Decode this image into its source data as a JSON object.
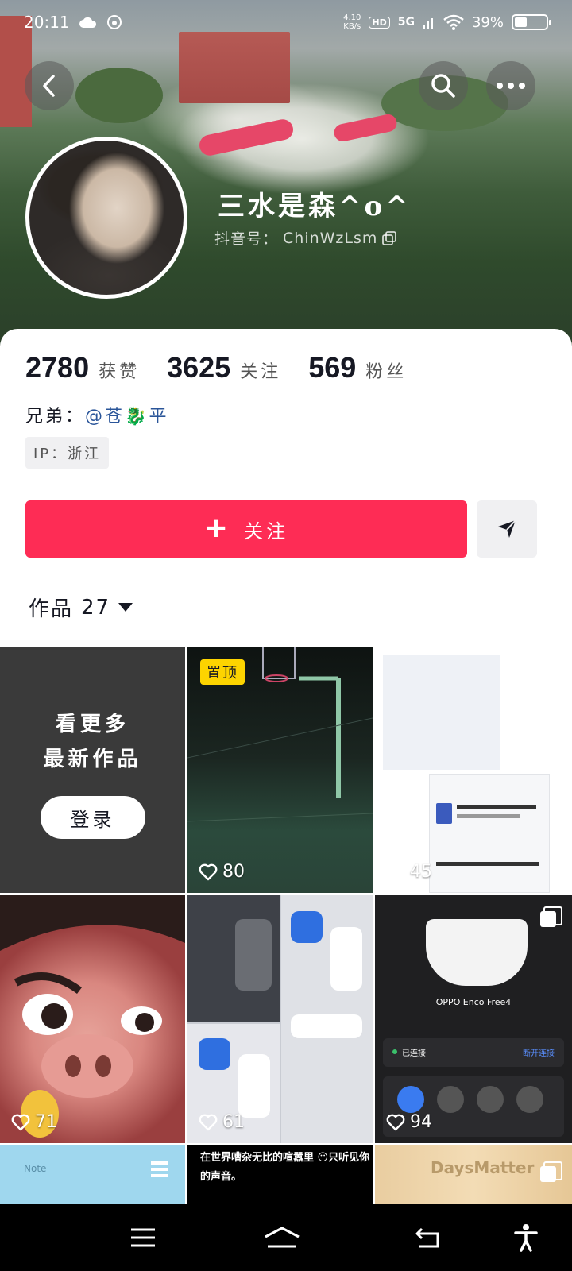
{
  "status_bar": {
    "time": "20:11",
    "net_speed": "4.10",
    "net_unit": "KB/s",
    "hd": "HD",
    "network": "5G",
    "battery_text": "39%",
    "battery_level": 0.39
  },
  "profile": {
    "username": "三水是森^o^",
    "douyin_id_label": "抖音号：",
    "douyin_id": "ChinWzLsm",
    "likes_count": "2780",
    "likes_label": "获赞",
    "following_count": "3625",
    "following_label": "关注",
    "followers_count": "569",
    "followers_label": "粉丝",
    "bio_prefix": "兄弟：",
    "bio_mention": "@苍",
    "bio_emoji": "🐉",
    "bio_suffix": "平",
    "ip": "IP：浙江"
  },
  "actions": {
    "follow_label": "关注",
    "follow_icon": "plus-icon",
    "share_icon": "send-icon"
  },
  "works_tab": {
    "label": "作品",
    "count": "27"
  },
  "grid": {
    "login_prompt_line1": "看更多",
    "login_prompt_line2": "最新作品",
    "login_button": "登录",
    "pinned_badge": "置顶",
    "tiles": [
      {
        "likes": "80"
      },
      {
        "likes": "45"
      },
      {
        "likes": "71"
      },
      {
        "likes": "61"
      },
      {
        "likes": "94"
      }
    ],
    "earbuds_title": "OPPO Enco Free4",
    "earbuds_connected": "已连接",
    "earbuds_disconnect": "断开连接",
    "bottom_caption": "在世界嘈杂无比的喧嚣里 😶只听见你的声音。",
    "note_label": "Note",
    "days_matter_label": "DaysMatter"
  },
  "colors": {
    "accent": "#fe2c55",
    "pin_badge": "#fdd400",
    "mention": "#2a5599"
  }
}
